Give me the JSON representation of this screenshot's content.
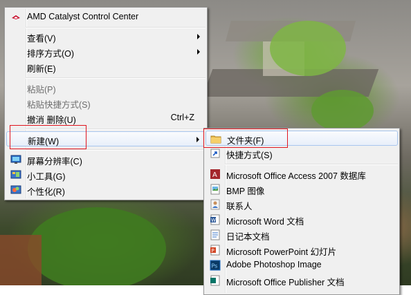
{
  "context_menu": {
    "items": [
      {
        "label": "AMD Catalyst Control Center",
        "icon": "amd-icon"
      },
      {
        "label": "查看(V)",
        "submenu": true
      },
      {
        "label": "排序方式(O)",
        "submenu": true
      },
      {
        "label": "刷新(E)"
      },
      {
        "label": "粘贴(P)",
        "disabled": true
      },
      {
        "label": "粘贴快捷方式(S)",
        "disabled": true
      },
      {
        "label": "撤消 删除(U)",
        "shortcut": "Ctrl+Z"
      },
      {
        "label": "新建(W)",
        "submenu": true,
        "highlighted": true
      },
      {
        "label": "屏幕分辨率(C)",
        "icon": "display-icon"
      },
      {
        "label": "小工具(G)",
        "icon": "gadgets-icon"
      },
      {
        "label": "个性化(R)",
        "icon": "personalize-icon"
      }
    ]
  },
  "new_submenu": {
    "items": [
      {
        "label": "文件夹(F)",
        "icon": "folder-icon",
        "highlighted": true
      },
      {
        "label": "快捷方式(S)",
        "icon": "shortcut-icon"
      },
      {
        "label": "Microsoft Office Access 2007 数据库",
        "icon": "access-icon"
      },
      {
        "label": "BMP 图像",
        "icon": "bmp-icon"
      },
      {
        "label": "联系人",
        "icon": "contact-icon"
      },
      {
        "label": "Microsoft Word 文档",
        "icon": "word-icon"
      },
      {
        "label": "日记本文档",
        "icon": "journal-icon"
      },
      {
        "label": "Microsoft PowerPoint 幻灯片",
        "icon": "powerpoint-icon"
      },
      {
        "label": "Adobe Photoshop Image",
        "icon": "photoshop-icon"
      },
      {
        "label": "Microsoft Office Publisher 文档",
        "icon": "publisher-icon"
      }
    ]
  },
  "colors": {
    "menu_background": "#f0f0f0",
    "highlight_border": "#a8c6ee",
    "annotation_red": "#e0141e"
  }
}
